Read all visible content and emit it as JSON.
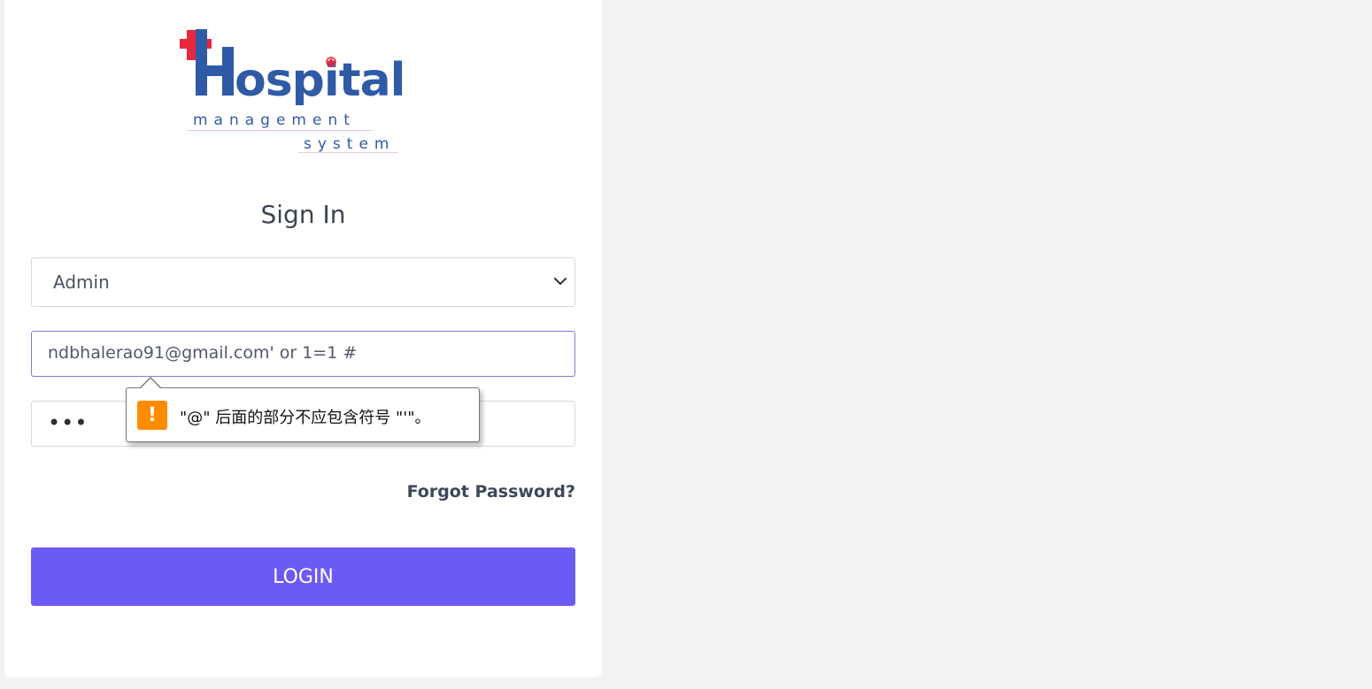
{
  "logo": {
    "word": "Hospital",
    "line2": "management",
    "line3": "system",
    "cross_color": "#e8263c",
    "text_color": "#2f5aa6"
  },
  "form": {
    "title": "Sign In",
    "role_select": {
      "value": "Admin"
    },
    "email_input": {
      "value": "ndbhalerao91@gmail.com' or 1=1 #"
    },
    "password_input": {
      "value": "•••"
    },
    "forgot_label": "Forgot Password?",
    "login_label": "LOGIN"
  },
  "validation_tooltip": {
    "icon": "warning-icon",
    "icon_glyph": "!",
    "message": "\"@\" 后面的部分不应包含符号 \"'\"。"
  },
  "colors": {
    "accent": "#6c5af5",
    "focus_border": "#8a76d6",
    "warning": "#ff8c00",
    "page_bg": "#f2f2f2"
  }
}
